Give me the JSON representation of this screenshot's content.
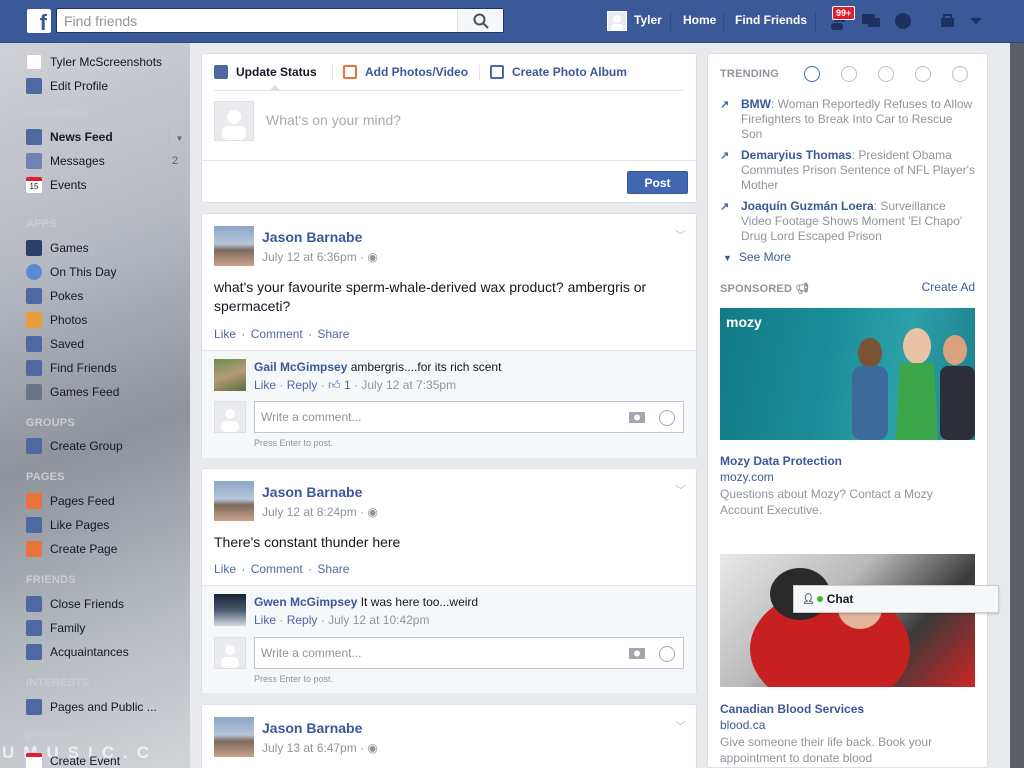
{
  "search": {
    "placeholder": "Find friends"
  },
  "topnav": {
    "user": "Tyler",
    "home": "Home",
    "find_friends": "Find Friends",
    "notif_count": "99+"
  },
  "sidebar": {
    "profile_name": "Tyler McScreenshots",
    "edit_profile": "Edit Profile",
    "sections": {
      "favorites": "FAVORITES",
      "apps": "APPS",
      "groups": "GROUPS",
      "pages": "PAGES",
      "friends": "FRIENDS",
      "interests": "INTERESTS",
      "events": "EVENTS"
    },
    "favorites": [
      {
        "label": "News Feed",
        "icon": "news-feed-icon"
      },
      {
        "label": "Messages",
        "icon": "messages-icon",
        "count": "2"
      },
      {
        "label": "Events",
        "icon": "events-icon"
      }
    ],
    "events_icon_number": "15",
    "apps": [
      {
        "label": "Games",
        "icon": "games-icon"
      },
      {
        "label": "On This Day",
        "icon": "on-this-day-icon"
      },
      {
        "label": "Pokes",
        "icon": "pokes-icon"
      },
      {
        "label": "Photos",
        "icon": "photos-icon"
      },
      {
        "label": "Saved",
        "icon": "saved-icon"
      },
      {
        "label": "Find Friends",
        "icon": "find-friends-icon"
      },
      {
        "label": "Games Feed",
        "icon": "games-feed-icon"
      }
    ],
    "groups": [
      {
        "label": "Create Group",
        "icon": "create-group-icon"
      }
    ],
    "pages": [
      {
        "label": "Pages Feed",
        "icon": "pages-feed-icon"
      },
      {
        "label": "Like Pages",
        "icon": "like-pages-icon"
      },
      {
        "label": "Create Page",
        "icon": "create-page-icon"
      }
    ],
    "friends": [
      {
        "label": "Close Friends",
        "icon": "close-friends-icon"
      },
      {
        "label": "Family",
        "icon": "family-icon"
      },
      {
        "label": "Acquaintances",
        "icon": "acquaintances-icon"
      }
    ],
    "interests": [
      {
        "label": "Pages and Public ...",
        "icon": "pages-public-icon"
      }
    ],
    "events": [
      {
        "label": "Create Event",
        "icon": "create-event-icon"
      }
    ],
    "watermark": "UMUSIC.C"
  },
  "composer": {
    "tabs": [
      "Update Status",
      "Add Photos/Video",
      "Create Photo Album"
    ],
    "placeholder": "What's on your mind?",
    "post_label": "Post"
  },
  "actions": {
    "like": "Like",
    "comment": "Comment",
    "share": "Share",
    "reply": "Reply",
    "sep": "·"
  },
  "comment_box": {
    "placeholder": "Write a comment...",
    "hint": "Press Enter to post."
  },
  "stories": [
    {
      "author": "Jason Barnabe",
      "time": "July 12 at 6:36pm",
      "text": "what's your favourite sperm-whale-derived wax product? ambergris or spermaceti?",
      "comment": {
        "author": "Gail McGimpsey",
        "text": "ambergris....for its rich scent",
        "likes": "1",
        "time": "July 12 at 7:35pm"
      }
    },
    {
      "author": "Jason Barnabe",
      "time": "July 12 at 8:24pm",
      "text": "There's constant thunder here",
      "comment": {
        "author": "Gwen McGimpsey",
        "text": "It was here too...weird",
        "time": "July 12 at 10:42pm"
      }
    },
    {
      "author": "Jason Barnabe",
      "time": "July 13 at 6:47pm"
    }
  ],
  "trending": {
    "header": "TRENDING",
    "items": [
      {
        "topic": "BMW",
        "text": "Woman Reportedly Refuses to Allow Firefighters to Break Into Car to Rescue Son"
      },
      {
        "topic": "Demaryius Thomas",
        "text": "President Obama Commutes Prison Sentence of NFL Player's Mother"
      },
      {
        "topic": "Joaquín Guzmán Loera",
        "text": "Surveillance Video Footage Shows Moment 'El Chapo' Drug Lord Escaped Prison"
      }
    ],
    "see_more": "See More"
  },
  "sponsored": {
    "header": "SPONSORED",
    "create_ad": "Create Ad",
    "ads": [
      {
        "logo": "mozy",
        "title": "Mozy Data Protection",
        "url": "mozy.com",
        "desc": "Questions about Mozy? Contact a Mozy Account Executive."
      },
      {
        "title": "Canadian Blood Services",
        "url": "blood.ca",
        "desc": "Give someone their life back. Book your appointment to donate blood"
      }
    ]
  },
  "chat": {
    "label": "Chat"
  },
  "colors": {
    "brand": "#3b5998",
    "link": "#4e69a2",
    "post_button": "#4267b2",
    "badge": "#e0202e"
  }
}
